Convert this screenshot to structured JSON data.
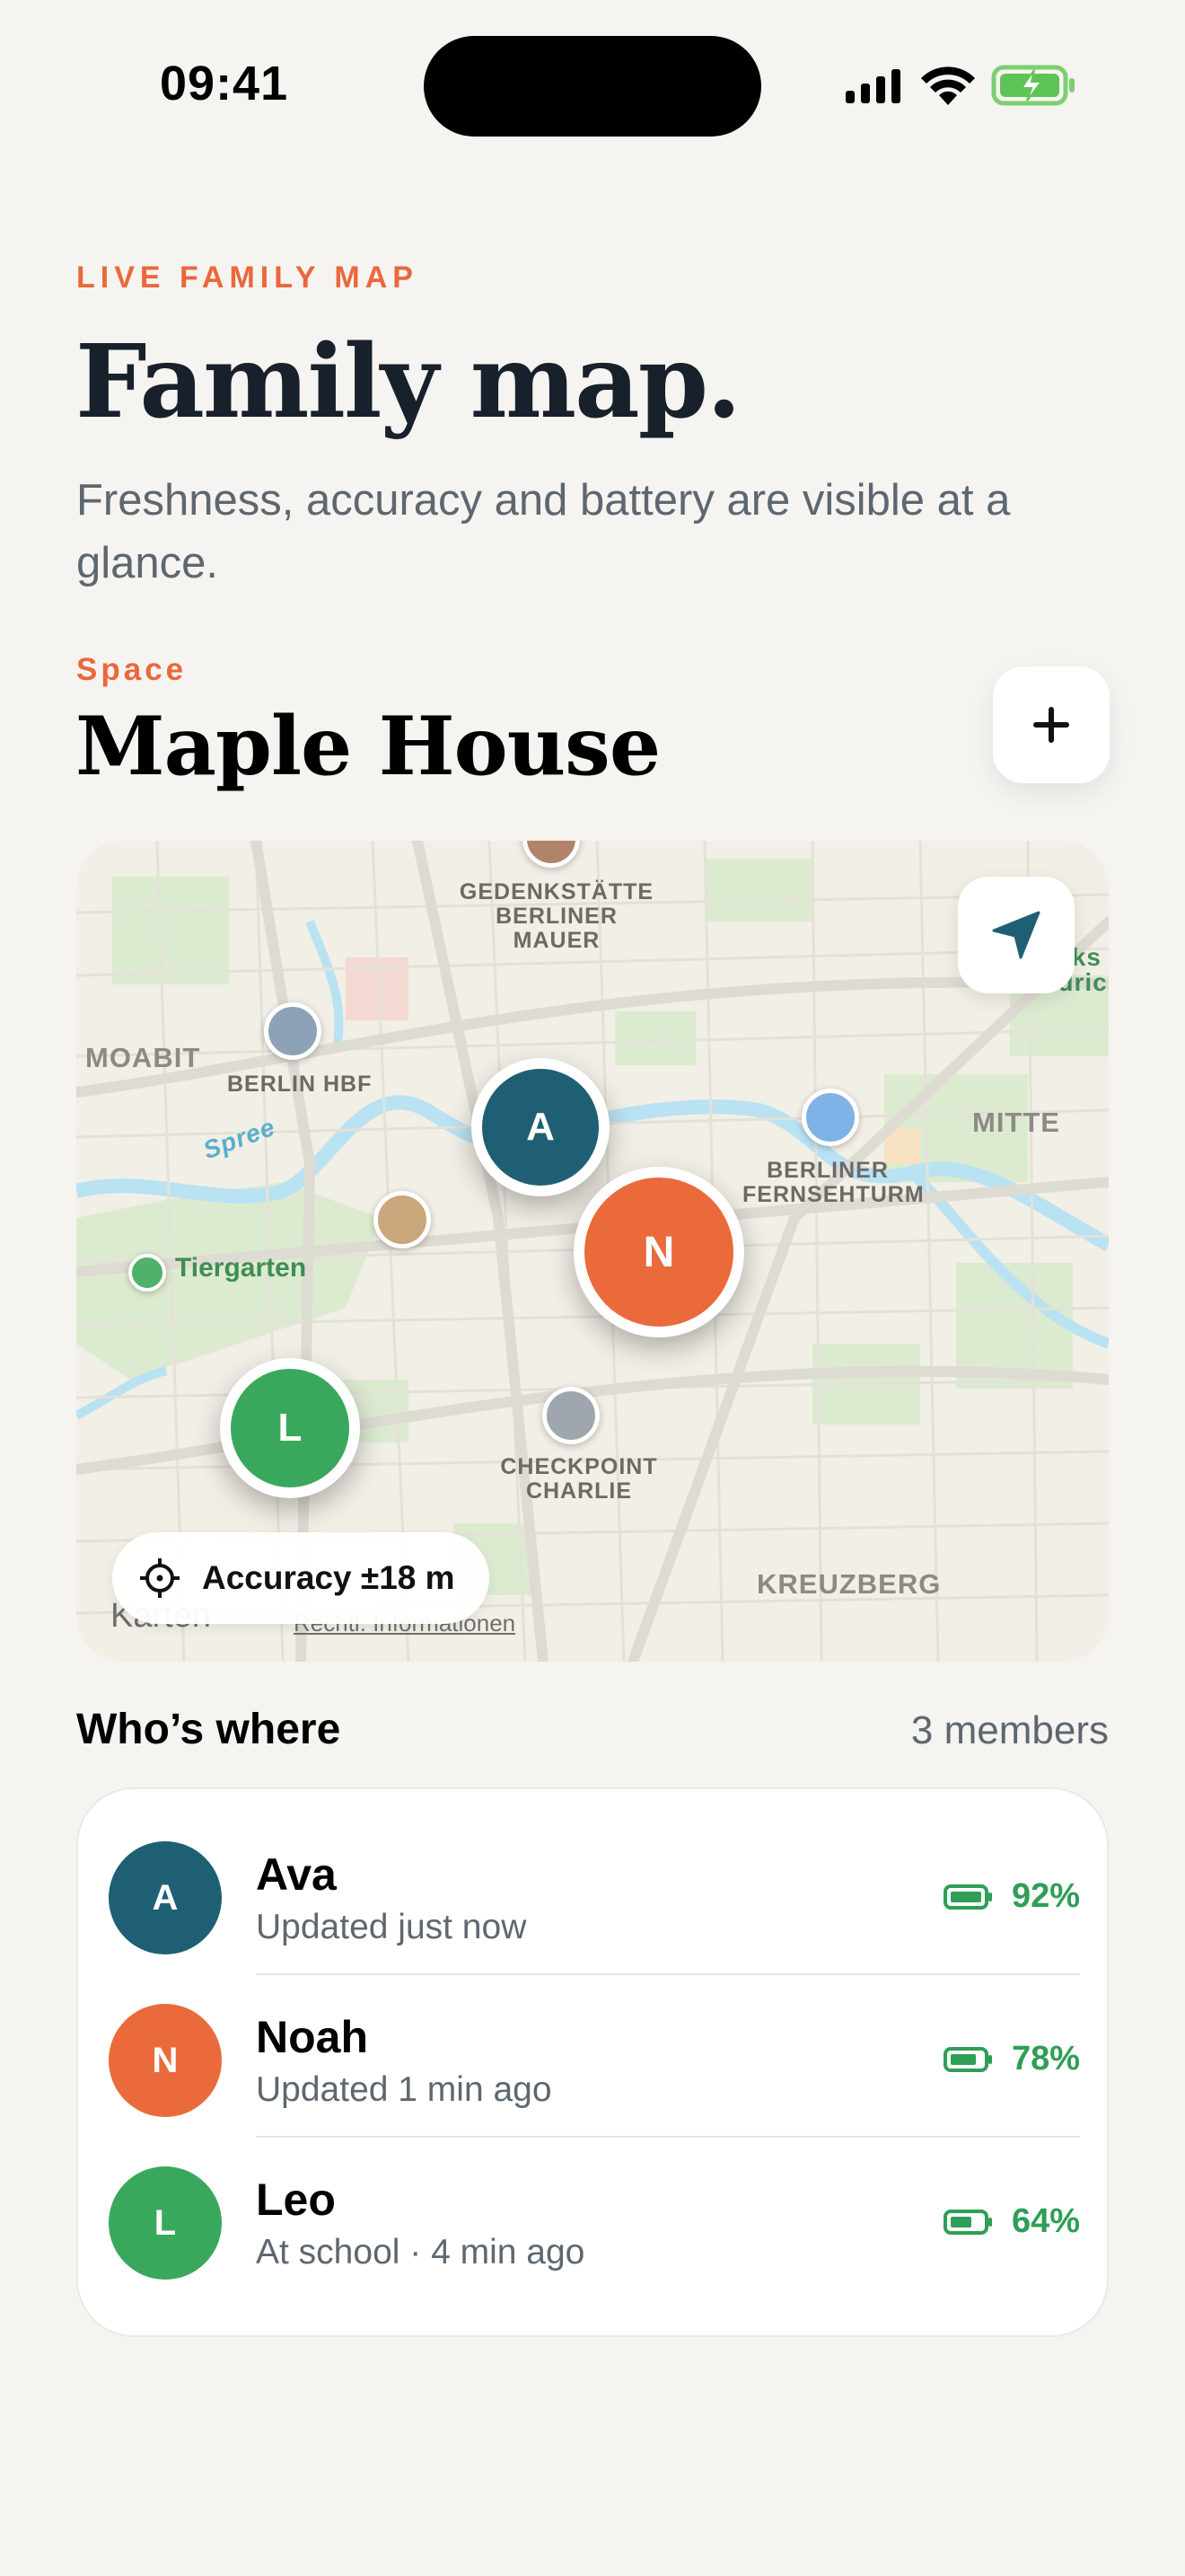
{
  "status_bar": {
    "time": "09:41"
  },
  "header": {
    "eyebrow": "LIVE FAMILY MAP",
    "title": "Family map.",
    "subtitle": "Freshness, accuracy and battery are visible at a glance."
  },
  "space": {
    "label": "Space",
    "name": "Maple House"
  },
  "map": {
    "labels": {
      "gedenk": "GEDENKSTÄTTE BERLINER MAUER",
      "moabit": "MOABIT",
      "hbf": "BERLIN HBF",
      "spree": "Spree",
      "tiergarten": "Tiergarten",
      "mitte": "MITTE",
      "tower": "BERLINER FERNSEHTURM",
      "checkpoint": "CHECKPOINT CHARLIE",
      "kreuzberg": "KREUZBERG",
      "edge_top": "lks",
      "edge_bottom": "iedrichs"
    },
    "pins": {
      "ava": "A",
      "noah": "N",
      "leo": "L"
    },
    "accuracy": "Accuracy ±18 m",
    "legal_brand": "Karten",
    "legal_link": "Rechtl. Informationen"
  },
  "members_section": {
    "title": "Who’s where",
    "count": "3 members"
  },
  "members": [
    {
      "initial": "A",
      "name": "Ava",
      "status": "Updated just now",
      "battery": "92%",
      "battery_level": 0.92,
      "color": "#1f5f74"
    },
    {
      "initial": "N",
      "name": "Noah",
      "status": "Updated 1 min ago",
      "battery": "78%",
      "battery_level": 0.78,
      "color": "#ea6a3c"
    },
    {
      "initial": "L",
      "name": "Leo",
      "status": "At school · 4 min ago",
      "battery": "64%",
      "battery_level": 0.64,
      "color": "#3aa85c"
    }
  ],
  "colors": {
    "accent": "#e9683c",
    "battery_green": "#2f9e57",
    "title": "#17202b"
  }
}
